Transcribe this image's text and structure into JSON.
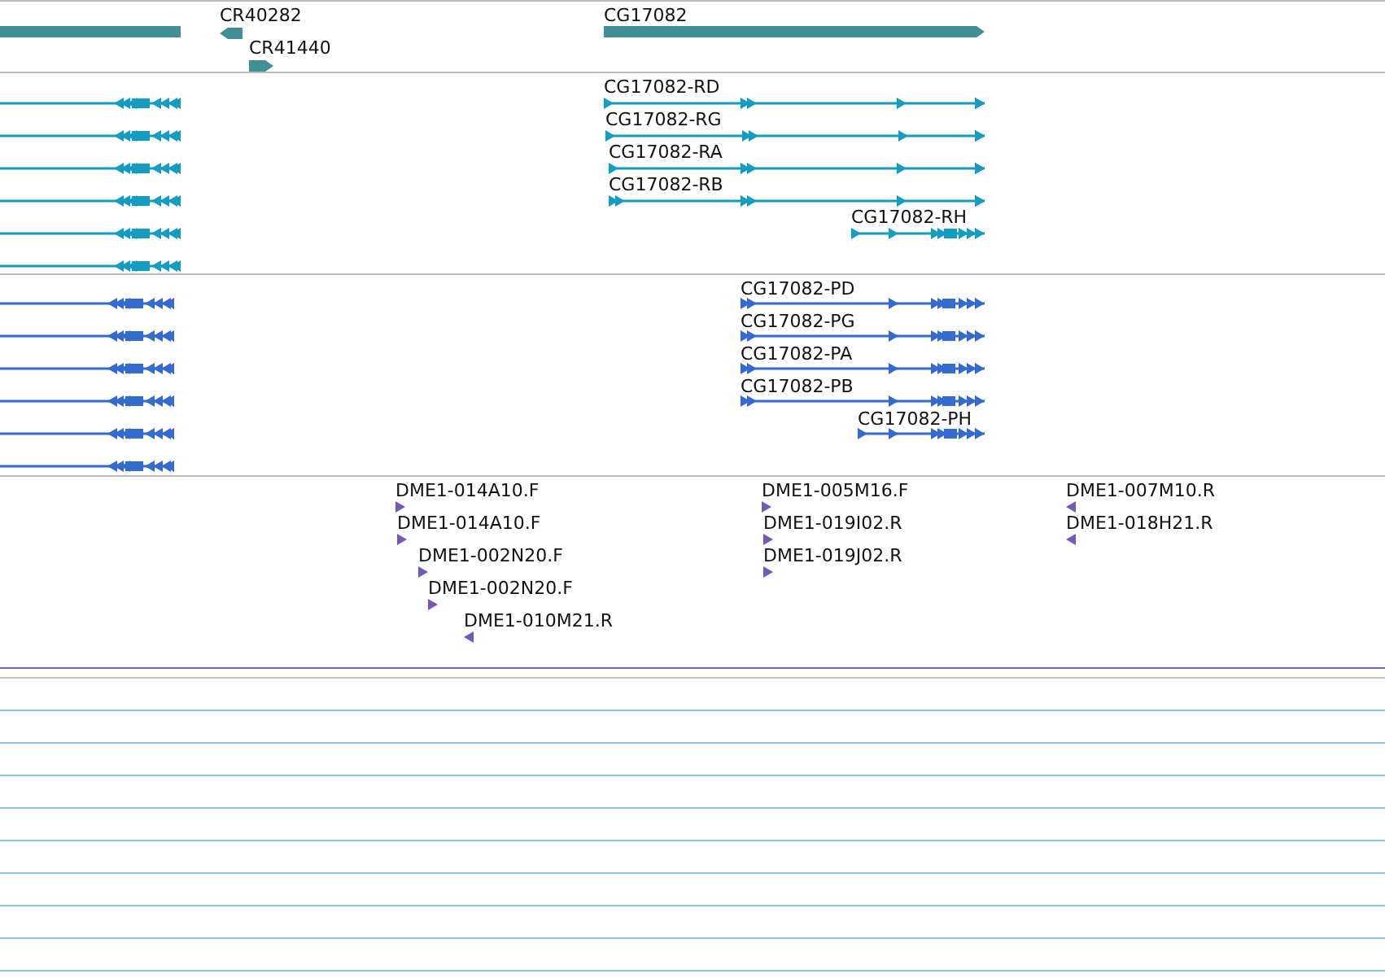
{
  "tracks": [
    {
      "kind": "gene",
      "features": [
        {
          "clipped": true
        },
        {
          "label": "CR40282",
          "reverse": true
        },
        {
          "label": "CR41440",
          "reverse": false
        },
        {
          "label": "CG17082",
          "reverse": false
        }
      ]
    },
    {
      "kind": "transcript",
      "features": [
        {
          "reverse": true
        },
        {
          "reverse": true
        },
        {
          "reverse": true
        },
        {
          "reverse": true
        },
        {
          "reverse": true
        },
        {
          "reverse": true
        },
        {
          "label": "CG17082-RD",
          "reverse": false
        },
        {
          "label": "CG17082-RG",
          "reverse": false
        },
        {
          "label": "CG17082-RA",
          "reverse": false
        },
        {
          "label": "CG17082-RB",
          "reverse": false
        },
        {
          "label": "CG17082-RH",
          "reverse": false
        }
      ]
    },
    {
      "kind": "protein",
      "features": [
        {
          "reverse": true
        },
        {
          "reverse": true
        },
        {
          "reverse": true
        },
        {
          "reverse": true
        },
        {
          "reverse": true
        },
        {
          "reverse": true
        },
        {
          "label": "CG17082-PD",
          "reverse": false
        },
        {
          "label": "CG17082-PG",
          "reverse": false
        },
        {
          "label": "CG17082-PA",
          "reverse": false
        },
        {
          "label": "CG17082-PB",
          "reverse": false
        },
        {
          "label": "CG17082-PH",
          "reverse": false
        }
      ]
    },
    {
      "kind": "est",
      "features": [
        {
          "label": "DME1-014A10.F",
          "reverse": false
        },
        {
          "label": "DME1-014A10.F",
          "reverse": false
        },
        {
          "label": "DME1-002N20.F",
          "reverse": false
        },
        {
          "label": "DME1-002N20.F",
          "reverse": false
        },
        {
          "label": "DME1-010M21.R",
          "reverse": true
        },
        {
          "label": "DME1-005M16.F",
          "reverse": false
        },
        {
          "label": "DME1-019I02.R",
          "reverse": false
        },
        {
          "label": "DME1-019J02.R",
          "reverse": false
        },
        {
          "label": "DME1-007M10.R",
          "reverse": true
        },
        {
          "label": "DME1-018H21.R",
          "reverse": true
        }
      ]
    },
    {
      "kind": "empty"
    }
  ]
}
